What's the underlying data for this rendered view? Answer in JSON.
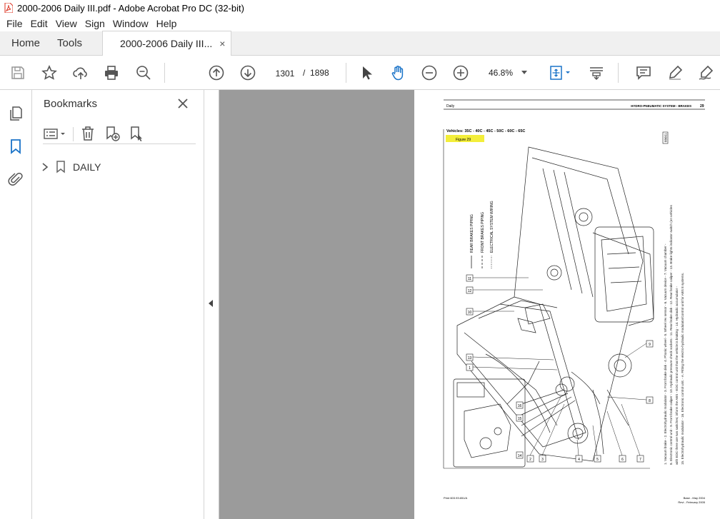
{
  "window": {
    "title": "2000-2006 Daily III.pdf - Adobe Acrobat Pro DC (32-bit)"
  },
  "menu": [
    "File",
    "Edit",
    "View",
    "Sign",
    "Window",
    "Help"
  ],
  "tabs": {
    "home": "Home",
    "tools": "Tools",
    "document": "2000-2006 Daily III...",
    "close": "×"
  },
  "toolbar": {
    "current_page": "1301",
    "page_separator": "/",
    "total_pages": "1898",
    "zoom": "46.8%"
  },
  "bookmarks_panel": {
    "title": "Bookmarks",
    "items": [
      {
        "label": "DAILY"
      }
    ]
  },
  "document_page": {
    "header_left": "Daily",
    "header_right": "HYDRO-PNEUMATIC SYSTEM - BRAKES",
    "page_number": "29",
    "vehicles": "Vehicles: 35C - 40C - 45C - 50C - 60C - 65C",
    "figure": "Figure 29",
    "legend": [
      "REAR BRAKES PIPING",
      "FRONT BRAKES PIPING",
      "ELECTRICAL SYSTEM WIRING"
    ],
    "caption_lines": [
      "1. Vacuum brake - 2. Electrohydraulic modulator - 3. Front brake disk - 4. Phonic wheel - 5. Wheel rev sensor - 6. Vacuum device - 7. Vacuum chamber -",
      "8. Electronic control unit - 9. Front brake caliper - 10. Hydraulic pressure check sockets - 11. Rear brake disk - 12. Rear brake caliper - 13. Brake lights indicator switch (on vehicles",
      "with EDC there are two switches; inform the ABS - EDC control unit that the vehicle is braking - 14. Hydraulic accumulator -",
      "15. Electrohydraulic modulator - 16. Electronic control unit. - A. Fitting the electro-hydraulic modulator/control unit for ABS 8 systems."
    ],
    "code": "88661",
    "footer_left": "Print 603.93.651/A",
    "footer_right_1": "Base - May 2004",
    "footer_right_2": "Revi - February 2005",
    "callouts": [
      "1",
      "2",
      "3",
      "4",
      "5",
      "6",
      "7",
      "8",
      "9",
      "10",
      "11",
      "12",
      "13",
      "14",
      "15",
      "16"
    ]
  }
}
